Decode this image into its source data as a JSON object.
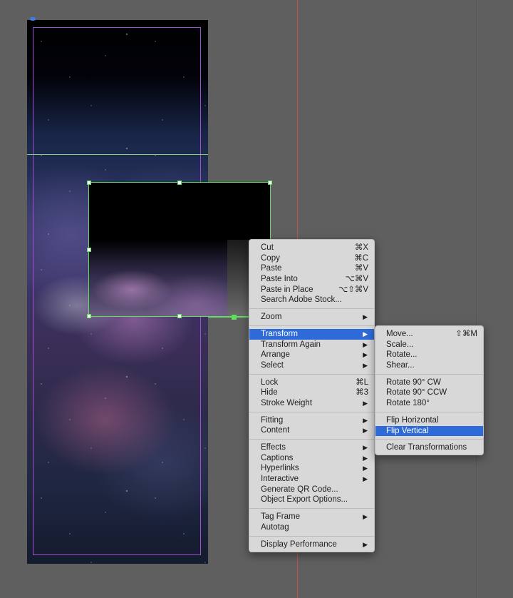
{
  "context_menu": {
    "groups": [
      [
        {
          "label": "Cut",
          "shortcut": "⌘X"
        },
        {
          "label": "Copy",
          "shortcut": "⌘C"
        },
        {
          "label": "Paste",
          "shortcut": "⌘V"
        },
        {
          "label": "Paste Into",
          "shortcut": "⌥⌘V"
        },
        {
          "label": "Paste in Place",
          "shortcut": "⌥⇧⌘V"
        },
        {
          "label": "Search Adobe Stock...",
          "shortcut": ""
        }
      ],
      [
        {
          "label": "Zoom",
          "submenu": true
        }
      ],
      [
        {
          "label": "Transform",
          "submenu": true,
          "highlighted": true
        },
        {
          "label": "Transform Again",
          "submenu": true
        },
        {
          "label": "Arrange",
          "submenu": true
        },
        {
          "label": "Select",
          "submenu": true
        }
      ],
      [
        {
          "label": "Lock",
          "shortcut": "⌘L"
        },
        {
          "label": "Hide",
          "shortcut": "⌘3"
        },
        {
          "label": "Stroke Weight",
          "submenu": true
        }
      ],
      [
        {
          "label": "Fitting",
          "submenu": true
        },
        {
          "label": "Content",
          "submenu": true
        }
      ],
      [
        {
          "label": "Effects",
          "submenu": true
        },
        {
          "label": "Captions",
          "submenu": true
        },
        {
          "label": "Hyperlinks",
          "submenu": true
        },
        {
          "label": "Interactive",
          "submenu": true
        },
        {
          "label": "Generate QR Code..."
        },
        {
          "label": "Object Export Options..."
        }
      ],
      [
        {
          "label": "Tag Frame",
          "submenu": true
        },
        {
          "label": "Autotag"
        }
      ],
      [
        {
          "label": "Display Performance",
          "submenu": true
        }
      ]
    ]
  },
  "transform_submenu": {
    "groups": [
      [
        {
          "label": "Move...",
          "shortcut": "⇧⌘M"
        },
        {
          "label": "Scale..."
        },
        {
          "label": "Rotate..."
        },
        {
          "label": "Shear..."
        }
      ],
      [
        {
          "label": "Rotate 90° CW"
        },
        {
          "label": "Rotate 90° CCW"
        },
        {
          "label": "Rotate 180°"
        }
      ],
      [
        {
          "label": "Flip Horizontal"
        },
        {
          "label": "Flip Vertical",
          "highlighted": true
        }
      ],
      [
        {
          "label": "Clear Transformations"
        }
      ]
    ]
  },
  "glyphs": {
    "submenu_arrow": "▶"
  },
  "colors": {
    "highlight": "#2f6bd8",
    "frame_selection": "#5ee05e",
    "margin_guide": "#a24fd6",
    "ruler_guide": "#c0544f"
  }
}
